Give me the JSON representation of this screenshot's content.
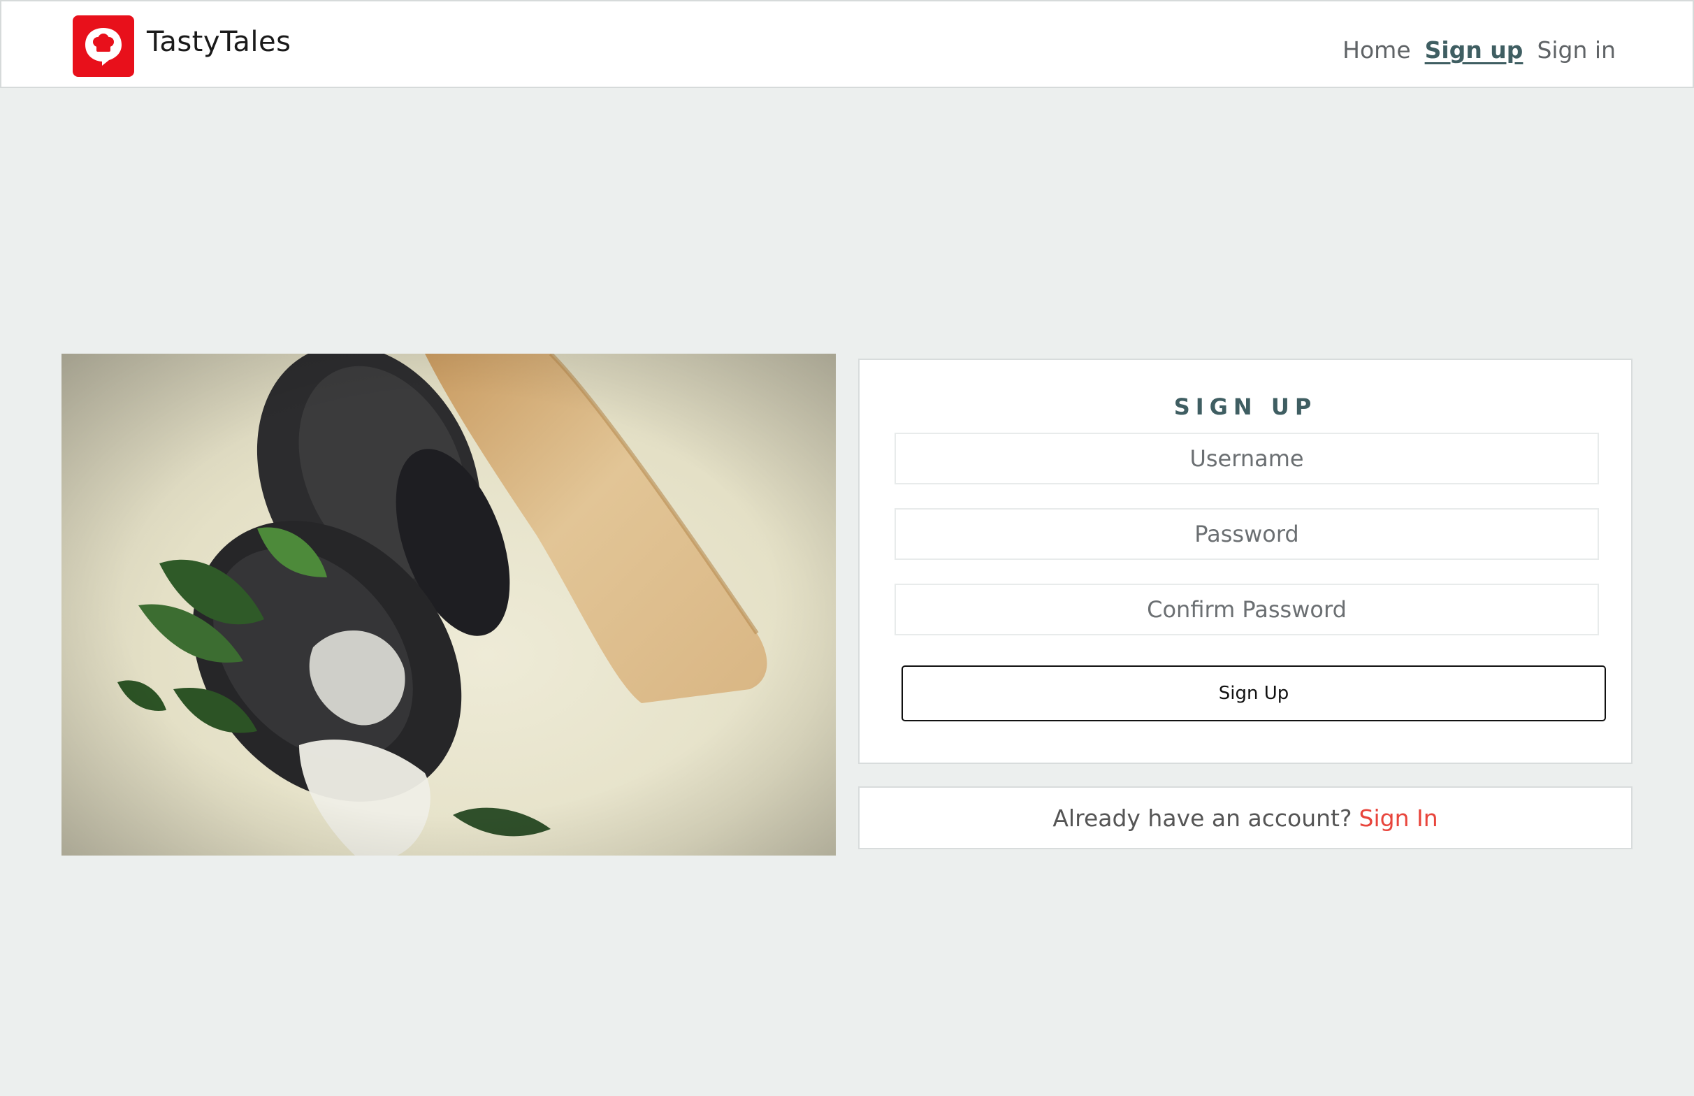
{
  "brand": {
    "name": "TastyTales",
    "logo_icon": "chef-hat-speech-bubble-icon",
    "logo_color": "#e8101b"
  },
  "nav": {
    "items": [
      {
        "label": "Home",
        "active": false
      },
      {
        "label": "Sign up",
        "active": true
      },
      {
        "label": "Sign in",
        "active": false
      }
    ]
  },
  "hero": {
    "image": "mussels-soup-with-bread-photo"
  },
  "signup": {
    "title": "SIGN UP",
    "username_placeholder": "Username",
    "password_placeholder": "Password",
    "confirm_placeholder": "Confirm Password",
    "submit_label": "Sign Up"
  },
  "signin_prompt": {
    "text": "Already have an account?",
    "link_label": "Sign In",
    "link_color": "#e8453c"
  },
  "colors": {
    "accent": "#3f5e62",
    "background": "#ecefee"
  }
}
